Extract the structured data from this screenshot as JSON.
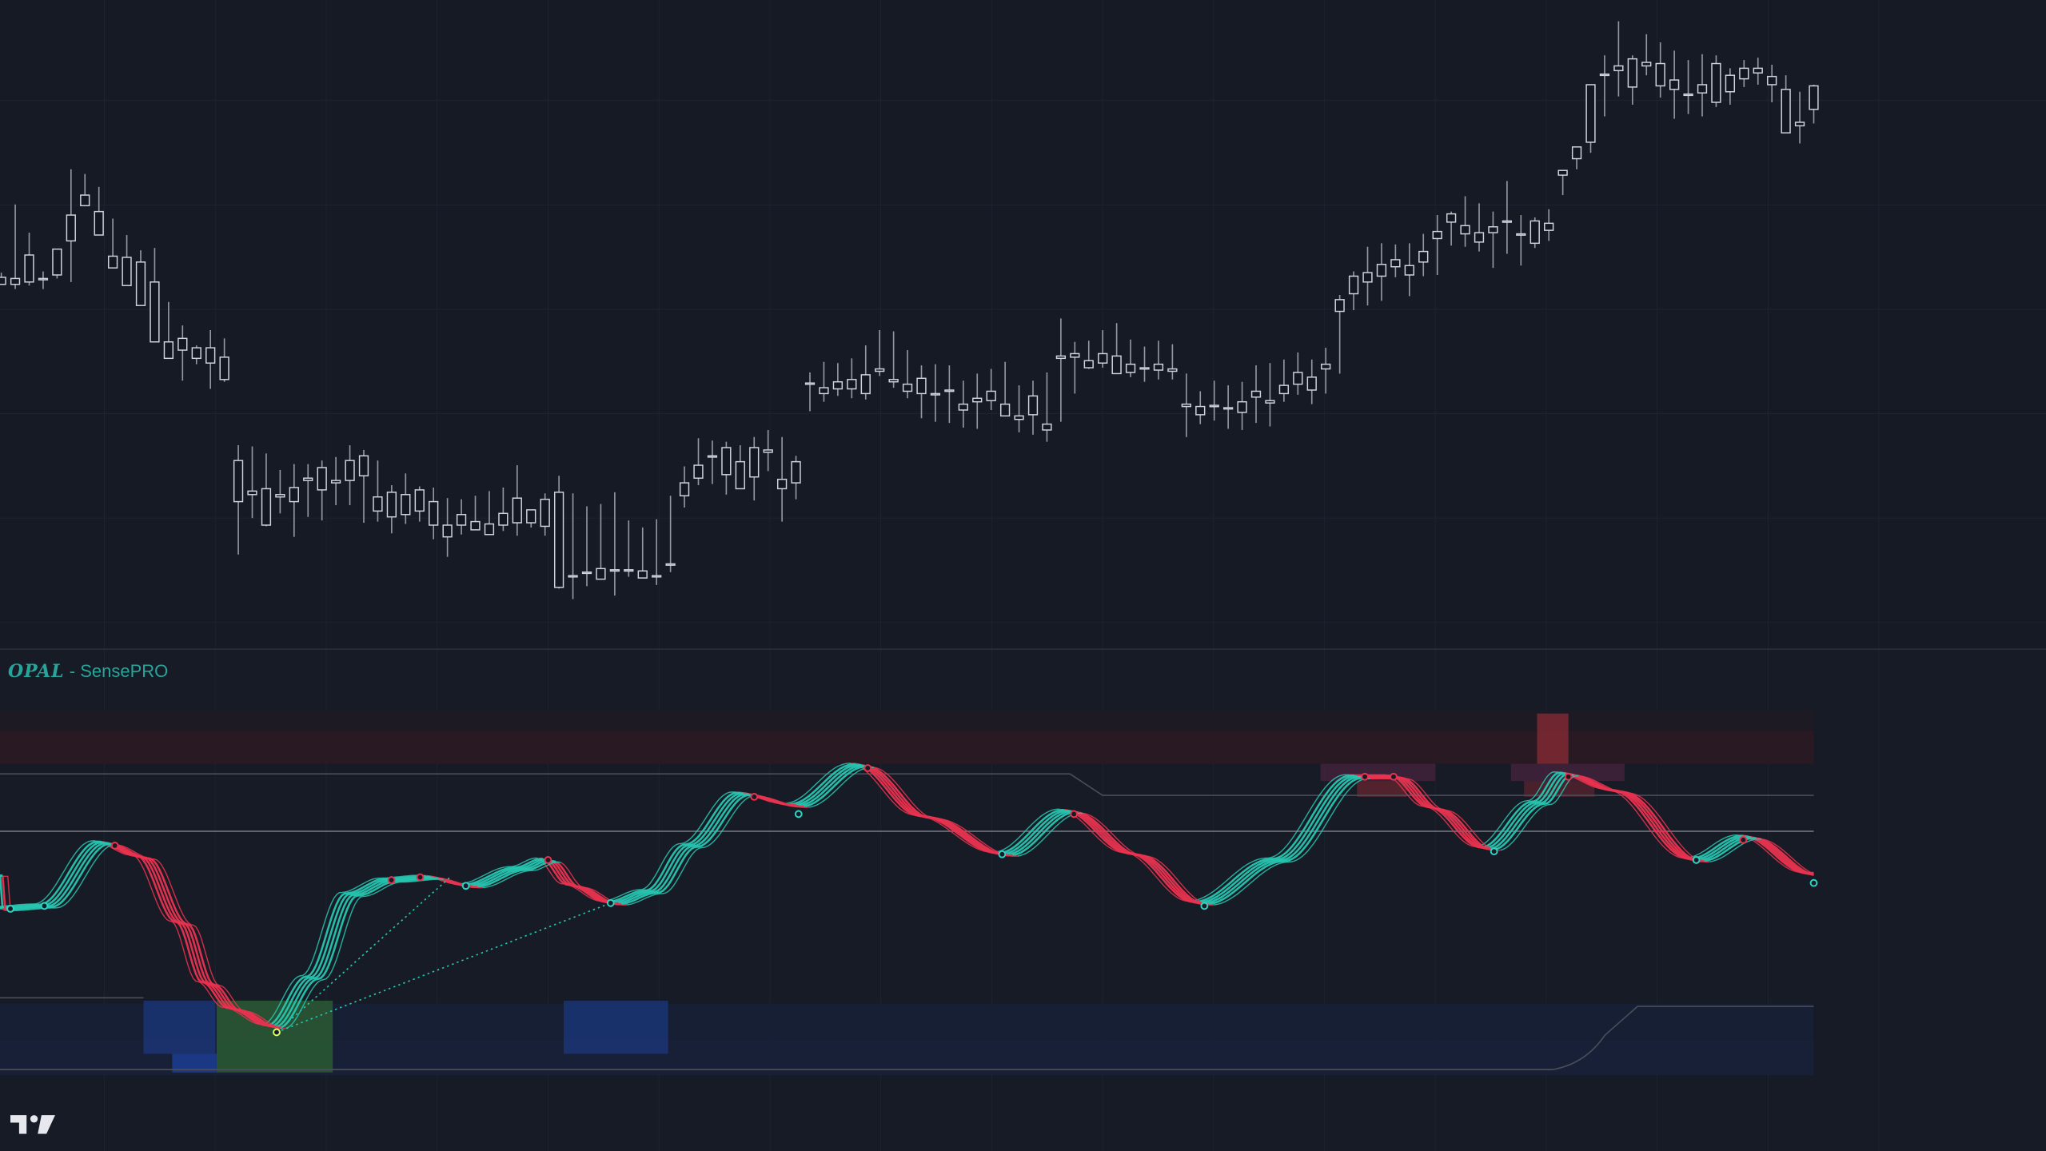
{
  "indicator": {
    "brand": "OPAL",
    "separator": " - ",
    "name": "SensePRO"
  },
  "logo": {
    "icon": "tradingview-logo-icon",
    "text": "TV"
  },
  "colors": {
    "background": "#161a25",
    "pane_background": "#171b26",
    "grid": "#1f2433",
    "pane_divider": "#2a2e39",
    "candle_body": "#131722",
    "candle_border": "#d1d4dc",
    "candle_wick": "#9598a1",
    "bull_wave": "#26c6b0",
    "bear_wave": "#e8334f",
    "top_zone": "#2a1a22",
    "bottom_zone": "#162038",
    "midline": "#6b6e78",
    "bull_block": "#1d3f97",
    "green_block": "#2a5a33",
    "red_block": "#7a2832"
  },
  "chart_data": [
    {
      "type": "candlestick",
      "series": [
        {
          "name": "",
          "open": [
            20.5,
            19.9,
            22.4,
            20.4,
            20.7,
            23.6,
            27.5,
            26.1,
            22.3,
            22.2,
            21.8,
            20.1,
            15.0,
            15.3,
            13.6,
            13.2,
            13.7,
            4.9,
            2.3,
            2.5,
            2.0,
            1.4,
            3.2,
            2.4,
            3.0,
            3.2,
            5.3,
            1.8,
            2.2,
            2.0,
            0.6,
            1.4,
            -0.6,
            0.3,
            -0.3,
            -1.4,
            -0.6,
            -0.4,
            0.7,
            1.6,
            2.2,
            -4.9,
            -4.6,
            -5.2,
            -4.4,
            -4.4,
            -5.1,
            -5.0,
            -3.9,
            1.9,
            3.4,
            5.3,
            3.7,
            4.8,
            3.5,
            5.8,
            3.3,
            3.0,
            11.4,
            11.1,
            11.6,
            11.0,
            12.2,
            12.5,
            11.6,
            11.4,
            10.6,
            10.6,
            10.9,
            9.7,
            9.9,
            10.8,
            9.7,
            8.7,
            8.8,
            7.5,
            13.8,
            13.7,
            13.4,
            14.0,
            13.8,
            13.1,
            12.7,
            13.1,
            12.5,
            9.7,
            9.5,
            9.6,
            9.4,
            9.9,
            10.3,
            9.8,
            11.3,
            11.4,
            10.9,
            13.1,
            18.6,
            20.6,
            20.1,
            21.6,
            22.0,
            20.7,
            22.7,
            23.8,
            25.2,
            24.2,
            24.3,
            24.8,
            25.2,
            24.2,
            23.4,
            25.1,
            29.2,
            31.6,
            32.0,
            37.8,
            38.5,
            36.7,
            38.5,
            38.7,
            36.5,
            36.0,
            36.9,
            35.4,
            36.3,
            38.3,
            38.3,
            37.6,
            36.5,
            33.7,
            34.8
          ],
          "high": [
            20.9,
            26.7,
            24.3,
            21.0,
            22.8,
            29.7,
            29.3,
            28.2,
            25.5,
            24.1,
            22.8,
            23.0,
            18.4,
            16.4,
            14.7,
            16.0,
            15.3,
            6.2,
            6.1,
            5.5,
            4.1,
            4.6,
            4.6,
            4.9,
            5.2,
            6.2,
            5.8,
            4.9,
            2.8,
            3.8,
            2.7,
            2.6,
            1.7,
            1.6,
            1.9,
            2.3,
            2.6,
            4.5,
            -0.1,
            2.1,
            3.6,
            2.1,
            1.0,
            1.2,
            2.2,
            -0.2,
            -0.8,
            -0.1,
            1.9,
            4.4,
            6.8,
            6.6,
            6.5,
            6.2,
            6.9,
            7.5,
            6.9,
            5.3,
            12.4,
            13.3,
            13.2,
            13.6,
            14.7,
            16.0,
            15.9,
            14.3,
            13.0,
            13.1,
            13.0,
            11.7,
            12.3,
            12.7,
            13.3,
            11.3,
            11.7,
            12.4,
            17.0,
            15.0,
            15.1,
            16.0,
            16.6,
            15.2,
            14.6,
            15.1,
            14.8,
            12.3,
            10.8,
            11.7,
            11.3,
            11.6,
            13.0,
            13.2,
            13.5,
            14.1,
            13.5,
            14.5,
            19.0,
            21.0,
            23.1,
            23.4,
            23.3,
            23.4,
            24.2,
            25.8,
            26.1,
            27.4,
            26.8,
            26.1,
            28.7,
            25.8,
            25.6,
            26.3,
            29.5,
            31.6,
            35.2,
            39.4,
            42.3,
            39.4,
            41.2,
            40.5,
            39.8,
            39.0,
            39.5,
            39.4,
            38.3,
            39.0,
            39.2,
            38.6,
            37.7,
            36.3,
            36.9
          ],
          "low": [
            19.9,
            19.5,
            19.8,
            19.5,
            20.4,
            20.1,
            27.0,
            25.3,
            21.6,
            21.0,
            21.3,
            19.4,
            13.8,
            11.7,
            13.1,
            11.0,
            11.6,
            -3.1,
            0.0,
            -0.7,
            0.4,
            -1.6,
            0.1,
            -0.2,
            1.1,
            1.1,
            -0.4,
            -0.3,
            -1.3,
            -0.5,
            -0.3,
            -1.8,
            -3.3,
            -1.4,
            -0.5,
            -1.4,
            -1.1,
            -1.5,
            -0.8,
            -1.5,
            -6.0,
            -6.9,
            -5.8,
            -5.2,
            -6.6,
            -5.0,
            -4.5,
            -5.7,
            -4.6,
            0.9,
            2.8,
            2.9,
            2.0,
            3.1,
            1.5,
            4.0,
            -0.3,
            1.6,
            9.1,
            9.9,
            10.4,
            10.2,
            10.1,
            12.1,
            11.1,
            10.2,
            8.5,
            8.2,
            8.1,
            7.7,
            7.6,
            9.2,
            8.7,
            7.3,
            7.1,
            6.5,
            8.2,
            10.6,
            12.7,
            12.8,
            12.5,
            12.0,
            11.6,
            11.8,
            11.8,
            6.9,
            8.0,
            8.3,
            7.6,
            7.5,
            8.1,
            7.8,
            9.9,
            10.5,
            9.7,
            10.6,
            12.3,
            17.7,
            18.1,
            18.5,
            20.5,
            18.9,
            20.6,
            20.7,
            23.2,
            23.1,
            22.7,
            21.3,
            22.5,
            21.5,
            23.0,
            23.6,
            27.5,
            29.7,
            31.1,
            34.2,
            35.9,
            35.2,
            37.7,
            35.8,
            34.0,
            34.4,
            34.2,
            35.0,
            35.2,
            36.7,
            36.9,
            35.4,
            32.8,
            31.9,
            33.6
          ],
          "close": [
            19.9,
            20.4,
            20.1,
            20.3,
            22.9,
            25.8,
            26.6,
            24.1,
            21.3,
            19.8,
            18.1,
            15.0,
            13.6,
            14.3,
            14.5,
            14.5,
            11.8,
            1.4,
            2.0,
            -0.6,
            1.8,
            2.6,
            3.4,
            4.3,
            3.2,
            4.9,
            3.6,
            0.6,
            0.1,
            0.3,
            2.4,
            -0.6,
            -1.6,
            -0.6,
            -1.0,
            -0.5,
            0.4,
            1.7,
            -0.4,
            -0.7,
            -5.9,
            -5.0,
            -4.6,
            -4.3,
            -4.4,
            -4.4,
            -4.5,
            -4.9,
            -4.0,
            3.0,
            4.5,
            5.2,
            6.0,
            2.5,
            6.0,
            5.6,
            2.5,
            4.8,
            11.5,
            10.6,
            11.0,
            11.8,
            10.6,
            12.7,
            11.8,
            10.8,
            11.9,
            10.5,
            10.8,
            9.2,
            10.2,
            10.0,
            8.7,
            8.4,
            10.4,
            8.0,
            13.6,
            14.0,
            12.8,
            13.2,
            12.3,
            12.4,
            12.8,
            12.6,
            12.7,
            9.5,
            8.8,
            9.6,
            9.3,
            9.0,
            10.8,
            10.0,
            10.6,
            12.4,
            12.0,
            12.7,
            17.6,
            19.1,
            20.9,
            20.6,
            21.4,
            21.5,
            21.8,
            24.4,
            25.9,
            24.9,
            23.5,
            24.3,
            25.3,
            24.2,
            25.3,
            24.5,
            29.6,
            30.6,
            36.9,
            37.8,
            38.1,
            39.1,
            38.8,
            36.8,
            37.3,
            36.1,
            36.2,
            38.7,
            37.7,
            37.4,
            37.9,
            36.9,
            32.8,
            33.4,
            36.8
          ]
        }
      ],
      "ylim": [
        -7,
        43
      ]
    },
    {
      "type": "line",
      "x_range": [
        0,
        1390
      ],
      "ylim": [
        -8.5,
        4.5
      ],
      "zones": {
        "top_outer": [
          3.5,
          4.2
        ],
        "top_inner": [
          2.35,
          3.5
        ],
        "top_line": [
          1.75,
          2.35
        ],
        "bottom_inner": [
          -6.0,
          -7.25
        ],
        "bottom_outer": [
          -7.25,
          -8.5
        ]
      },
      "midline": 0,
      "series": [
        {
          "name": "",
          "x": [
            0,
            35,
            80,
            110,
            140,
            160,
            180,
            210,
            240,
            270,
            300,
            330,
            360,
            400,
            420,
            440,
            470,
            500,
            530,
            570,
            610,
            660,
            710,
            770,
            820,
            870,
            920,
            980,
            1040,
            1070,
            1100,
            1140,
            1180,
            1200,
            1240,
            1300,
            1340,
            1390
          ],
          "y": [
            -2.7,
            -2.6,
            -0.4,
            -0.9,
            -3.2,
            -5.3,
            -6.2,
            -6.8,
            -5.1,
            -2.2,
            -1.7,
            -1.6,
            -1.9,
            -1.3,
            -1.0,
            -1.9,
            -2.5,
            -2.1,
            -0.5,
            1.3,
            0.9,
            2.3,
            0.5,
            -0.8,
            0.7,
            -0.8,
            -2.5,
            -1.0,
            1.9,
            1.9,
            0.8,
            -0.6,
            1.0,
            2.0,
            1.4,
            -1.0,
            -0.2,
            -1.5
          ]
        }
      ],
      "wave_count": 6
    }
  ]
}
